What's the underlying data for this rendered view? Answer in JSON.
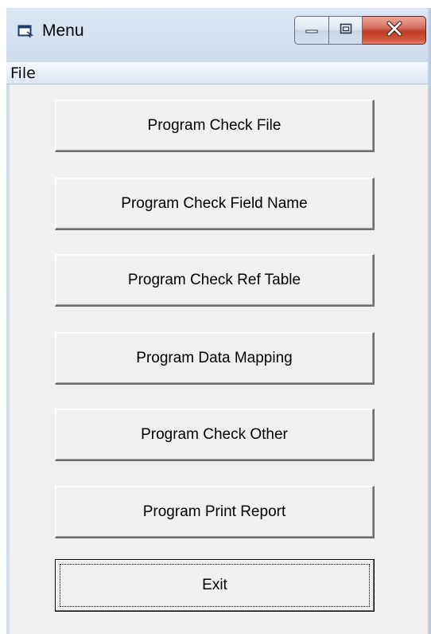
{
  "window": {
    "title": "Menu",
    "icon": "form-window-icon",
    "caption_buttons": {
      "minimize": "minimize-icon",
      "maximize": "maximize-icon",
      "close": "close-icon"
    }
  },
  "menubar": {
    "items": [
      {
        "label": "File"
      }
    ]
  },
  "buttons": [
    {
      "label": "Program Check File"
    },
    {
      "label": "Program Check Field Name"
    },
    {
      "label": "Program Check Ref Table"
    },
    {
      "label": "Program Data Mapping"
    },
    {
      "label": "Program Check Other"
    },
    {
      "label": "Program Print Report"
    },
    {
      "label": "Exit",
      "default": true
    }
  ],
  "colors": {
    "close_button": "#c13b25",
    "button_face": "#f0f0f0",
    "frame": "#d5e1f0"
  }
}
